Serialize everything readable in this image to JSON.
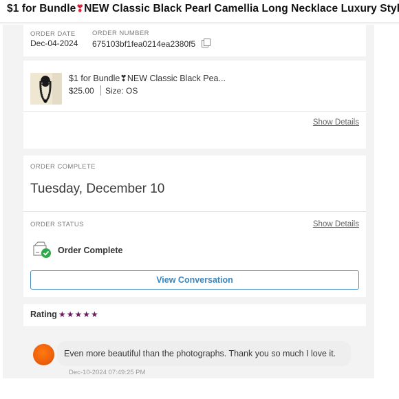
{
  "title": {
    "before": "$1 for Bundle",
    "heart": "❣",
    "after": "NEW Classic Black Pearl Camellia Long Necklace Luxury Style"
  },
  "order_meta": {
    "date_label": "ORDER DATE",
    "date_value": "Dec-04-2024",
    "number_label": "ORDER NUMBER",
    "number_value": "675103bf1fea0214ea2380f5"
  },
  "item": {
    "name": "$1 for Bundle❣NEW Classic Black Pea...",
    "price": "$25.00",
    "size": "Size: OS",
    "details_link": "Show Details"
  },
  "completion": {
    "label": "ORDER COMPLETE",
    "date": "Tuesday, December 10"
  },
  "status": {
    "label": "ORDER STATUS",
    "details_link": "Show Details",
    "text": "Order Complete",
    "button": "View Conversation"
  },
  "rating": {
    "label": "Rating",
    "stars": "★★★★★",
    "value": 5
  },
  "review": {
    "text": "Even more beautiful than the photographs. Thank you so much I love it.",
    "timestamp": "Dec-10-2024 07:49:25 PM"
  },
  "colors": {
    "link_blue": "#3a86c0",
    "star_purple": "#6a1b5a",
    "check_green": "#2eaa4a",
    "avatar_orange": "#f0620a"
  },
  "icons": [
    "copy-icon",
    "package-check-icon"
  ]
}
